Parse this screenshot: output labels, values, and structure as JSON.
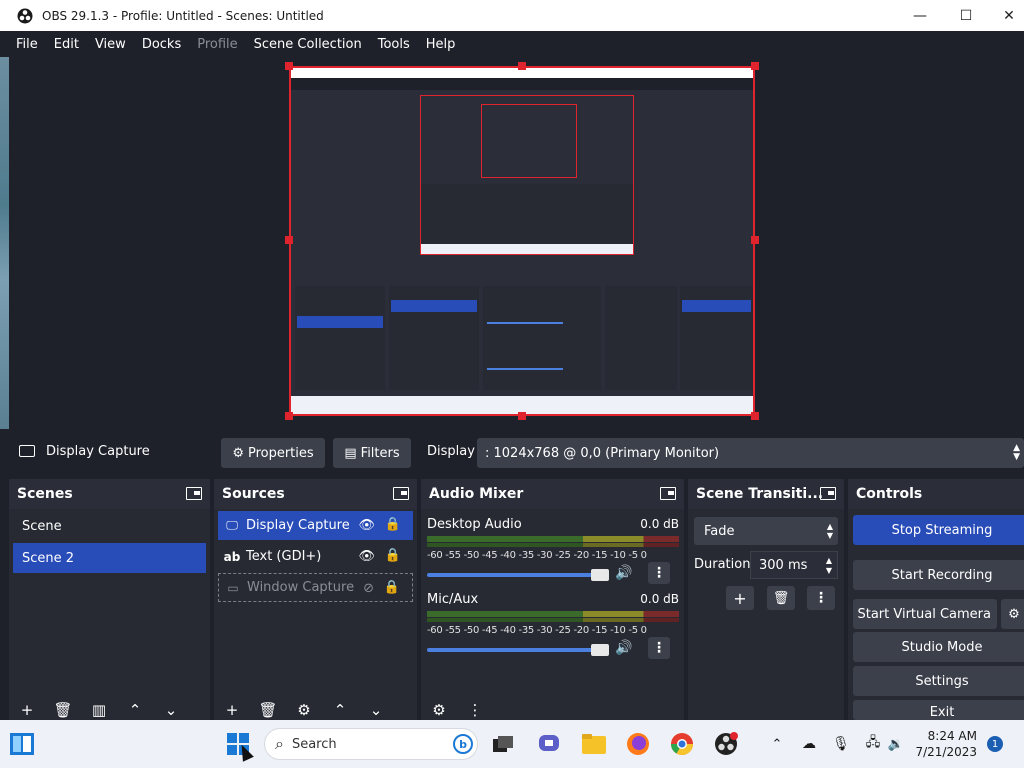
{
  "window": {
    "title": "OBS 29.1.3 - Profile: Untitled - Scenes: Untitled",
    "minimize": "—",
    "maximize": "☐",
    "close": "✕"
  },
  "menu": {
    "items": [
      "File",
      "Edit",
      "View",
      "Docks",
      "Profile",
      "Scene Collection",
      "Tools",
      "Help"
    ]
  },
  "source_toolbar": {
    "source_name": "Display Capture",
    "properties_label": "Properties",
    "filters_label": "Filters",
    "display_label": "Display",
    "display_value": ": 1024x768 @ 0,0 (Primary Monitor)"
  },
  "scenes": {
    "title": "Scenes",
    "items": [
      "Scene",
      "Scene 2"
    ],
    "selected": "Scene 2"
  },
  "sources": {
    "title": "Sources",
    "items": [
      {
        "name": "Display Capture",
        "icon": "monitor-icon",
        "selected": true,
        "visible": true
      },
      {
        "name": "Text (GDI+)",
        "icon": "text-icon",
        "selected": false,
        "visible": true
      },
      {
        "name": "Window Capture",
        "icon": "window-icon",
        "selected": false,
        "visible": false
      }
    ]
  },
  "audio_mixer": {
    "title": "Audio Mixer",
    "scale": "-60 -55 -50 -45 -40 -35 -30 -25 -20 -15 -10 -5 0",
    "channels": [
      {
        "name": "Desktop Audio",
        "db": "0.0 dB",
        "volume": 1.0
      },
      {
        "name": "Mic/Aux",
        "db": "0.0 dB",
        "volume": 1.0
      }
    ]
  },
  "transitions": {
    "title": "Scene Transiti...",
    "transition": "Fade",
    "duration_label": "Duration",
    "duration_value": "300 ms"
  },
  "controls": {
    "title": "Controls",
    "stop_streaming": "Stop Streaming",
    "start_recording": "Start Recording",
    "start_virtual_camera": "Start Virtual Camera",
    "studio_mode": "Studio Mode",
    "settings": "Settings",
    "exit": "Exit"
  },
  "taskbar": {
    "search_placeholder": "Search",
    "time": "8:24 AM",
    "date": "7/21/2023",
    "notifications": "1"
  },
  "colors": {
    "accent": "#284cb8",
    "preview_border": "#e0242e",
    "panel": "#272a33",
    "background": "#1f212a"
  }
}
